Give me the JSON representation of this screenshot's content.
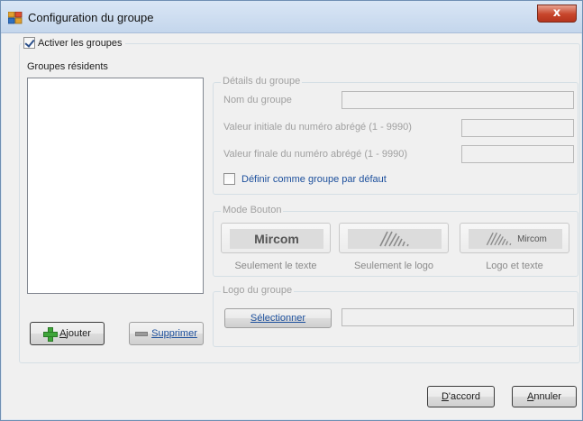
{
  "window": {
    "title": "Configuration du groupe",
    "close_glyph": "x"
  },
  "enable_groups": {
    "label": "Activer les groupes",
    "checked": true
  },
  "residents": {
    "label": "Groupes résidents",
    "items": [],
    "add_button": {
      "prefix": "",
      "accel": "A",
      "rest": "jouter",
      "icon": "plus-icon"
    },
    "remove_button": {
      "accel": "S",
      "rest": "upprimer",
      "icon": "minus-icon"
    }
  },
  "details": {
    "title": "Détails du groupe",
    "name_label": "Nom du groupe",
    "name_value": "",
    "initial_label": "Valeur initiale du numéro abrégé (1 - 9990)",
    "initial_value": "",
    "final_label": "Valeur finale du numéro abrégé (1 - 9990)",
    "final_value": "",
    "default_checkbox": {
      "label": "Définir comme groupe par défaut",
      "checked": false
    }
  },
  "mode": {
    "title": "Mode Bouton",
    "buttons": [
      {
        "caption": "Seulement le texte",
        "text": "Mircom"
      },
      {
        "caption": "Seulement le logo",
        "text": ""
      },
      {
        "caption": "Logo et texte",
        "text": "Mircom"
      }
    ]
  },
  "logo": {
    "title": "Logo du groupe",
    "select_accel": "S",
    "select_rest": "électionner",
    "path_value": ""
  },
  "footer": {
    "ok": {
      "accel": "D",
      "rest": "'accord"
    },
    "cancel": {
      "accel": "A",
      "rest": "nnuler"
    }
  },
  "colors": {
    "accent_blue": "#1c4f9c",
    "title_bar": "#c4d6ec",
    "close_red": "#c7452b"
  }
}
